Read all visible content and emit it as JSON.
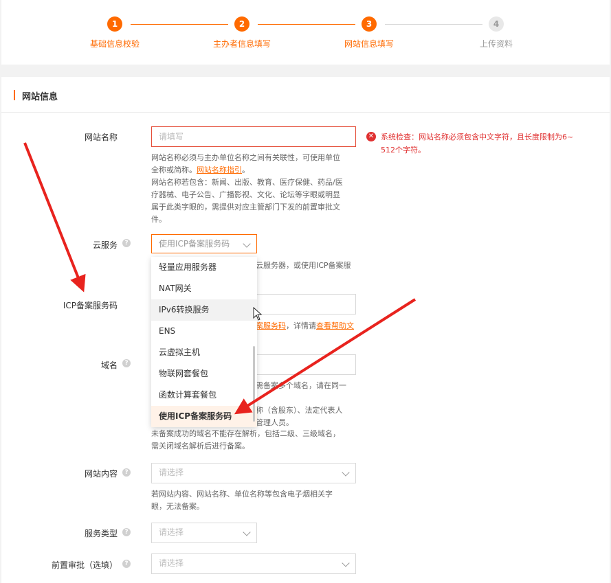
{
  "steps": [
    {
      "number": "1",
      "label": "基础信息校验",
      "state": "active"
    },
    {
      "number": "2",
      "label": "主办者信息填写",
      "state": "active"
    },
    {
      "number": "3",
      "label": "网站信息填写",
      "state": "active"
    },
    {
      "number": "4",
      "label": "上传资料",
      "state": "todo"
    }
  ],
  "section": {
    "title": "网站信息"
  },
  "fields": {
    "site_name": {
      "label": "网站名称",
      "placeholder": "请填写",
      "hint_line1": "网站名称必须与主办单位名称之间有关联性，可使用单位",
      "hint_line2": "全称或简称。",
      "hint_link": "网站名称指引",
      "hint_period": "。",
      "hint_line3": "网站名称若包含：新闻、出版、教育、医疗保健、药品/医",
      "hint_line4": "疗器械、电子公告、广播影视、文化、论坛等字眼或明显",
      "hint_line5": "属于此类字眼的，需提供对应主管部门下发的前置审批文",
      "hint_line6": "件。"
    },
    "cloud_service": {
      "label": "云服务",
      "selected": "使用ICP备案服务码",
      "hint_line1_partial": "云服务器，或使用ICP备案服"
    },
    "icp_code": {
      "label": "ICP备案服务码",
      "hint_partial_link": "案服务码",
      "hint_partial_text": "，详情请",
      "hint_link2": "查看帮助文"
    },
    "domain": {
      "label": "域名",
      "hint_a": "需备案多个域名，请在同一",
      "hint_b": "称（含股东）、法定代表人",
      "hint_c": "管理人员。",
      "hint_line4": "未备案成功的域名不能存在解析，包括二级、三级域名，",
      "hint_line5": "需关闭域名解析后进行备案。"
    },
    "site_content": {
      "label": "网站内容",
      "placeholder": "请选择",
      "hint_line1": "若网站内容、网站名称、单位名称等包含电子烟相关字",
      "hint_line2": "眼，无法备案。"
    },
    "service_type": {
      "label": "服务类型",
      "placeholder": "请选择"
    },
    "pre_approval": {
      "label": "前置审批（选填）",
      "placeholder": "请选择"
    }
  },
  "error": {
    "icon": "error-x-icon",
    "line1": "系统检查：网站名称必须包含中文字符，且长度限制为6~",
    "line2": "512个字符。"
  },
  "dropdown": {
    "items": [
      "轻量应用服务器",
      "NAT网关",
      "IPv6转换服务",
      "ENS",
      "云虚拟主机",
      "物联网套餐包",
      "函数计算套餐包",
      "使用ICP备案服务码"
    ],
    "hovered": "IPv6转换服务",
    "selected": "使用ICP备案服务码"
  },
  "colors": {
    "accent": "#ff6a00",
    "error": "#e03131",
    "arrow": "#e8231e"
  }
}
